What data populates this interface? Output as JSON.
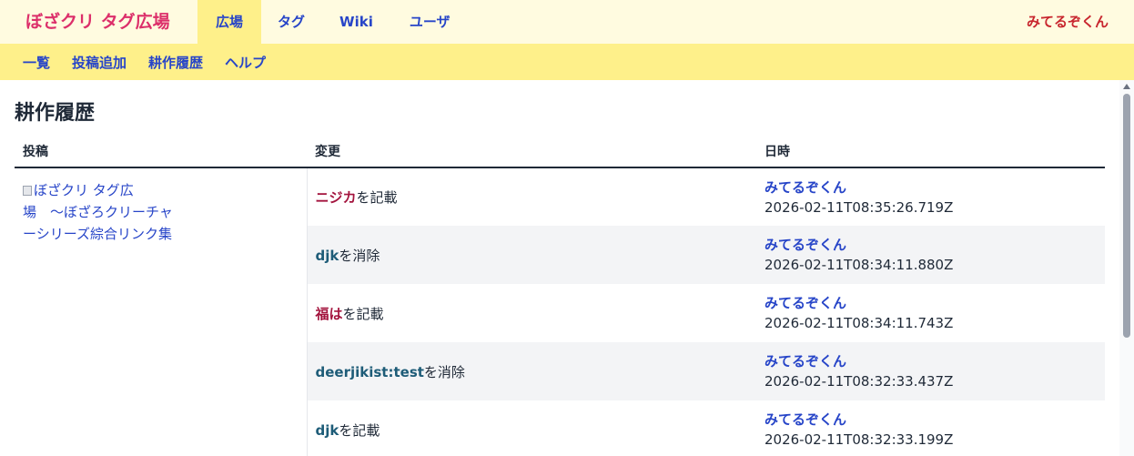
{
  "header": {
    "brand": "ぼざクリ タグ広場",
    "nav": [
      "広場",
      "タグ",
      "Wiki",
      "ユーザ"
    ],
    "user": "みてるぞくん"
  },
  "subnav": [
    "一覧",
    "投稿追加",
    "耕作履歴",
    "ヘルプ"
  ],
  "page": {
    "title": "耕作履歴",
    "columns": [
      "投稿",
      "変更",
      "日時"
    ]
  },
  "post": {
    "link_text": "ぼざクリ タグ広場　〜ぼざろクリーチャーシリーズ綜合リンク集"
  },
  "rows": [
    {
      "tag": "ニジカ",
      "suffix": "を記載",
      "user": "みてるぞくん",
      "time": "2026-02-11T08:35:26.719Z"
    },
    {
      "tag": "djk",
      "suffix": "を消除",
      "user": "みてるぞくん",
      "time": "2026-02-11T08:34:11.880Z"
    },
    {
      "tag": "福は",
      "suffix": "を記載",
      "user": "みてるぞくん",
      "time": "2026-02-11T08:34:11.743Z"
    },
    {
      "tag": "deerjikist:test",
      "suffix": "を消除",
      "user": "みてるぞくん",
      "time": "2026-02-11T08:32:33.437Z"
    },
    {
      "tag": "djk",
      "suffix": "を記載",
      "user": "みてるぞくん",
      "time": "2026-02-11T08:32:33.199Z"
    }
  ],
  "colors": {
    "brand": "#dc2f6a",
    "link": "#2745c8",
    "tag_added": "#a3133d",
    "tag_removed": "#1e5c78",
    "topbar_bg": "#fffbe0",
    "subbar_bg": "#fef08a"
  }
}
